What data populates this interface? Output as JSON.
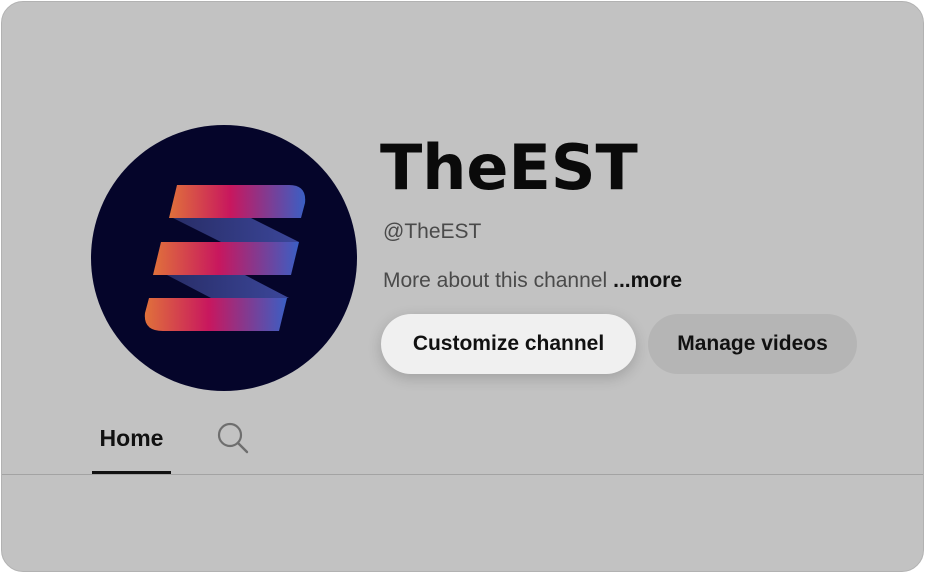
{
  "channel": {
    "name": "TheEST",
    "handle": "@TheEST",
    "about_text": "More about this channel",
    "more_link": "...more"
  },
  "actions": {
    "customize_label": "Customize channel",
    "manage_label": "Manage videos"
  },
  "tabs": [
    {
      "label": "Home",
      "active": true
    }
  ],
  "icons": {
    "avatar": "channel-logo-icon",
    "search": "search-icon"
  },
  "colors": {
    "background": "#c2c2c2",
    "avatar_bg": "#05052a",
    "logo_gradient": [
      "#e0713b",
      "#c8175e",
      "#3a5fc4"
    ]
  }
}
